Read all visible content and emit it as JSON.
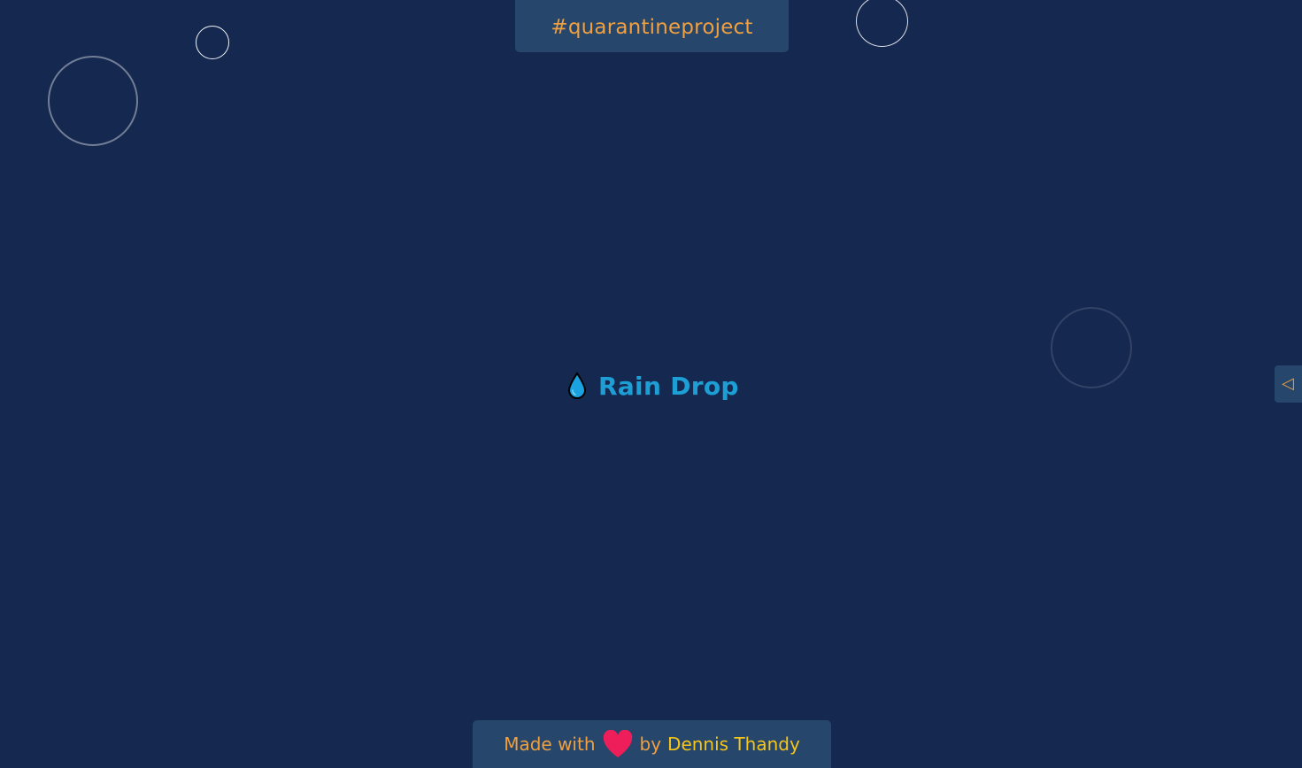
{
  "header": {
    "tag": "#quarantineproject"
  },
  "main": {
    "title": "Rain Drop",
    "title_icon": "raindrop-icon",
    "title_color": "#1d9fd6"
  },
  "side_panel": {
    "toggle_icon": "◁"
  },
  "footer": {
    "made_with": "Made with",
    "heart_icon": "heart-icon",
    "by": "by",
    "author": "Dennis Thandy"
  },
  "colors": {
    "background": "#152850",
    "panel": "#26466b",
    "accent": "#f0a040",
    "author": "#f5c518",
    "heart": "#ee1e5a"
  }
}
